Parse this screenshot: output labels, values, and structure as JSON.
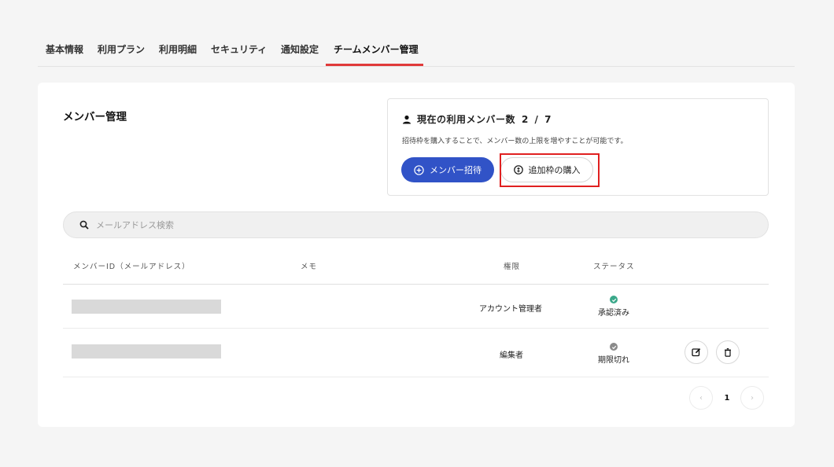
{
  "tabs": [
    {
      "label": "基本情報"
    },
    {
      "label": "利用プラン"
    },
    {
      "label": "利用明細"
    },
    {
      "label": "セキュリティ"
    },
    {
      "label": "通知設定"
    },
    {
      "label": "チームメンバー管理",
      "active": true
    }
  ],
  "page_title": "メンバー管理",
  "member_box": {
    "count_label": "現在の利用メンバー数",
    "count_value": "2 / 7",
    "hint": "招待枠を購入することで、メンバー数の上限を増やすことが可能です。",
    "invite_button": "メンバー招待",
    "buy_button": "追加枠の購入"
  },
  "search": {
    "placeholder": "メールアドレス検索",
    "value": ""
  },
  "table": {
    "headers": [
      "メンバーID（メールアドレス）",
      "メモ",
      "権限",
      "ステータス"
    ],
    "rows": [
      {
        "role": "アカウント管理者",
        "status": "承認済み",
        "status_color": "#3aa88a",
        "actions": false
      },
      {
        "role": "編集者",
        "status": "期限切れ",
        "status_color": "#8a8a8a",
        "actions": true
      }
    ]
  },
  "pagination": {
    "prev": "‹",
    "current": "1",
    "next": "›"
  },
  "colors": {
    "accent": "#3153c7",
    "tab_underline": "#e03a3a",
    "highlight": "#e02020"
  }
}
